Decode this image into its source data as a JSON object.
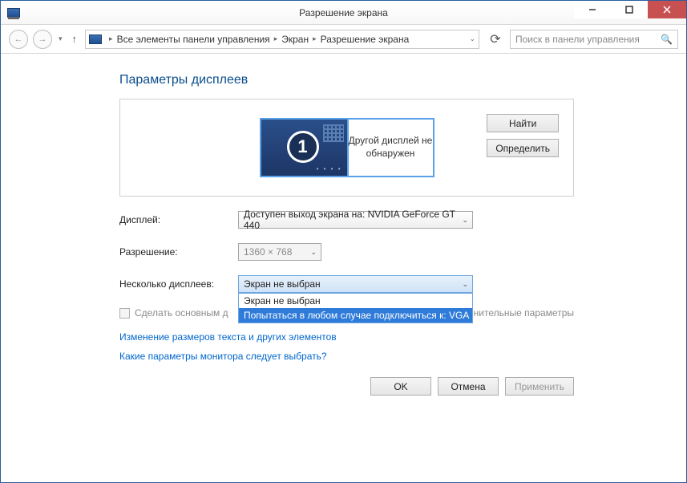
{
  "title": "Разрешение экрана",
  "breadcrumbs": {
    "root": "Все элементы панели управления",
    "mid": "Экран",
    "leaf": "Разрешение экрана"
  },
  "search_placeholder": "Поиск в панели управления",
  "heading": "Параметры дисплеев",
  "displays": {
    "primary_number": "1",
    "secondary_text": "Другой дисплей не обнаружен",
    "btn_find": "Найти",
    "btn_identify": "Определить"
  },
  "fields": {
    "display_label": "Дисплей:",
    "display_value": "Доступен выход экрана на: NVIDIA GeForce GT 440",
    "resolution_label": "Разрешение:",
    "resolution_value": "1360 × 768",
    "multi_label": "Несколько дисплеев:",
    "multi_value": "Экран не выбран",
    "multi_options": {
      "opt0": "Экран не выбран",
      "opt1": "Попытаться в любом случае подключиться к: VGA"
    }
  },
  "checkbox_label": "Сделать основным д",
  "advanced_link_tail": "лнительные параметры",
  "links": {
    "resize_text": "Изменение размеров текста и других элементов",
    "which_settings": "Какие параметры монитора следует выбрать?"
  },
  "buttons": {
    "ok": "OK",
    "cancel": "Отмена",
    "apply": "Применить"
  }
}
